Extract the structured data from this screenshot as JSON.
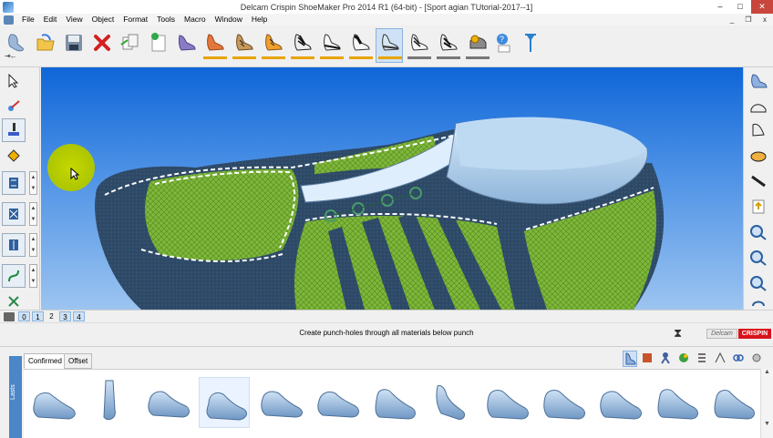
{
  "window": {
    "title": "Delcam Crispin ShoeMaker Pro 2014 R1 (64-bit) - [Sport agian TUtorial-2017--1]",
    "minimize": "–",
    "maximize": "□",
    "close": "✕"
  },
  "menu": {
    "items": [
      "File",
      "Edit",
      "View",
      "Object",
      "Format",
      "Tools",
      "Macro",
      "Window",
      "Help"
    ],
    "mdi_minimize": "_",
    "mdi_restore": "❐",
    "mdi_close": "x"
  },
  "toolbar": {
    "buttons": [
      {
        "icon": "last-icon"
      },
      {
        "icon": "open-icon"
      },
      {
        "icon": "save-icon"
      },
      {
        "icon": "delete-icon"
      },
      {
        "icon": "copy-icon"
      },
      {
        "icon": "new-icon"
      },
      {
        "icon": "shoe-purple-icon"
      },
      {
        "icon": "shoe-orange-icon"
      },
      {
        "icon": "shoe-tan-icon"
      },
      {
        "icon": "shoe-orange-lace-icon"
      },
      {
        "icon": "shoe-lace-black-icon"
      },
      {
        "icon": "shoe-white-black-icon"
      },
      {
        "icon": "shoe-black-white-icon"
      },
      {
        "icon": "shoe-white-icon"
      },
      {
        "icon": "shoe-selected-icon"
      },
      {
        "icon": "shoe-black-icon"
      },
      {
        "icon": "shoe-spring-icon"
      },
      {
        "icon": "shoe-gear-icon"
      },
      {
        "icon": "help-icon"
      },
      {
        "icon": "pointer-tool-icon"
      }
    ],
    "arrows_label": "⇥←"
  },
  "layers": {
    "items": [
      "0",
      "1",
      "2",
      "3",
      "4"
    ],
    "active": "0"
  },
  "status": {
    "message": "Create punch-holes through all materials below punch",
    "hourglass": "⧗",
    "brand1": "Delcam",
    "brand2": "CRISPIN"
  },
  "bottom": {
    "side_label": "Lasts",
    "tabs": [
      "Confirmed",
      "Offset"
    ],
    "active_tab": "Confirmed",
    "scroll_up": "▲",
    "scroll_down": "▼"
  },
  "colors": {
    "viewport_top": "#0f66d8",
    "mesh_green": "#7fb83a",
    "leather_navy": "#2d4966",
    "collar_light": "#b6d6ee",
    "brand_red": "#d8141c",
    "highlight": "#cfe2f5"
  }
}
